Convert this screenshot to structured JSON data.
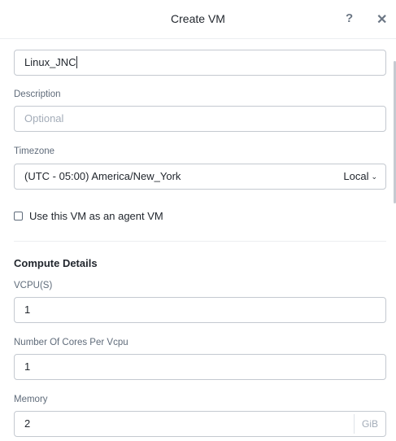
{
  "header": {
    "title": "Create VM",
    "help_glyph": "?",
    "close_glyph": "✕"
  },
  "form": {
    "name_value": "Linux_JNC",
    "description_label": "Description",
    "description_placeholder": "Optional",
    "timezone_label": "Timezone",
    "timezone_value": "(UTC - 05:00) America/New_York",
    "timezone_mode": "Local",
    "timezone_chevron": "⌄",
    "agent_vm_label": "Use this VM as an agent VM",
    "agent_vm_checked": false
  },
  "compute": {
    "title": "Compute Details",
    "vcpu_label": "VCPU(S)",
    "vcpu_value": "1",
    "cores_label": "Number Of Cores Per Vcpu",
    "cores_value": "1",
    "memory_label": "Memory",
    "memory_value": "2",
    "memory_unit": "GiB"
  },
  "icons": {
    "help": "help-icon",
    "close": "close-icon",
    "chevron": "chevron-down-icon"
  },
  "colors": {
    "border": "#c4c9d0",
    "text": "#22272e",
    "label": "#5f6b7a",
    "placeholder": "#a3acb8"
  }
}
